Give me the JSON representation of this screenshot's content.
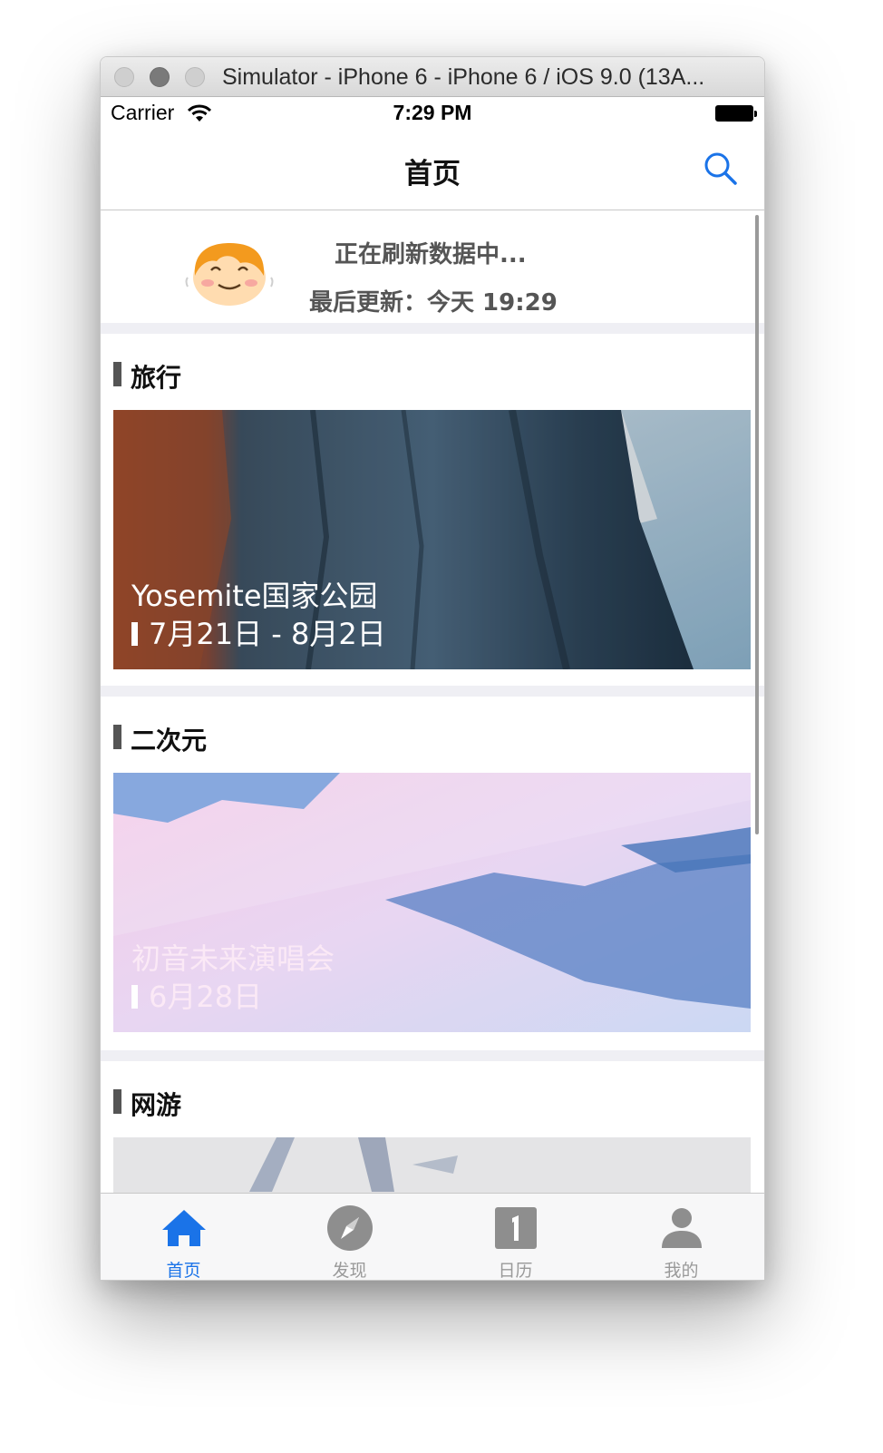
{
  "window": {
    "title": "Simulator - iPhone 6 - iPhone 6 / iOS 9.0 (13A..."
  },
  "status_bar": {
    "carrier": "Carrier",
    "time": "7:29 PM"
  },
  "nav": {
    "title": "首页"
  },
  "refresh": {
    "status": "正在刷新数据中...",
    "last_updated": "最后更新：今天 19:29"
  },
  "sections": [
    {
      "label": "旅行",
      "card_title": "Yosemite国家公园",
      "card_date": "7月21日 - 8月2日"
    },
    {
      "label": "二次元",
      "card_title": "初音未来演唱会",
      "card_date": "6月28日"
    },
    {
      "label": "网游"
    }
  ],
  "tabs": [
    {
      "label": "首页",
      "icon": "home-icon",
      "active": true
    },
    {
      "label": "发现",
      "icon": "compass-icon"
    },
    {
      "label": "日历",
      "icon": "calendar-icon"
    },
    {
      "label": "我的",
      "icon": "person-icon"
    }
  ],
  "colors": {
    "accent": "#1a73e8",
    "inactive": "#999999",
    "section_bar": "#555555"
  }
}
